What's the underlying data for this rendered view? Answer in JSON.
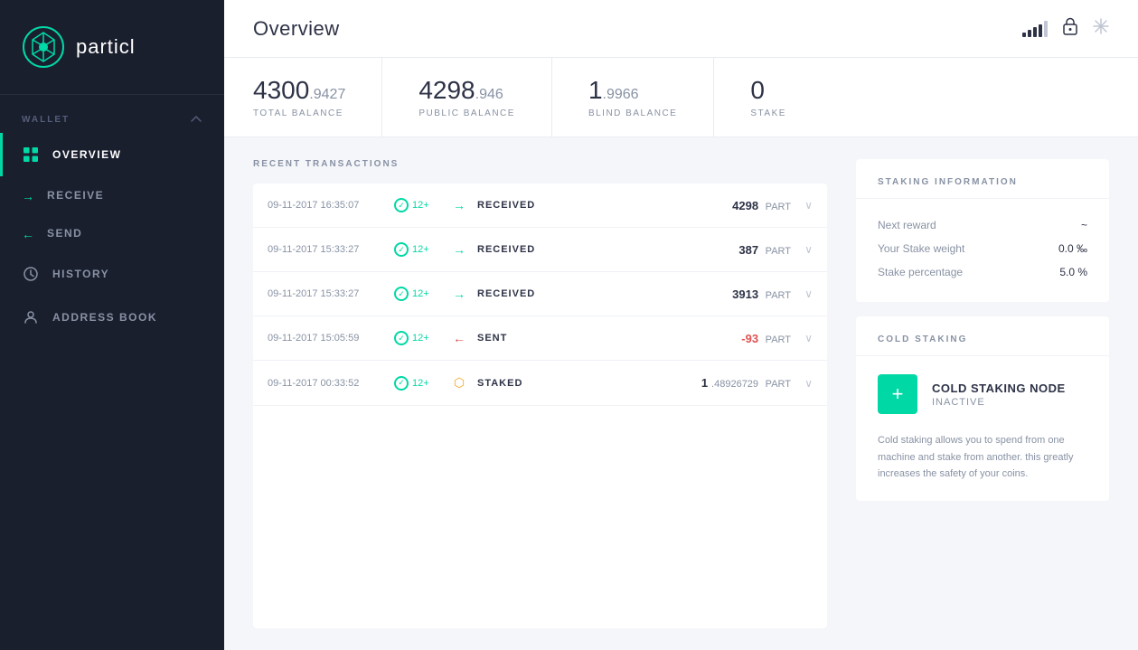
{
  "app": {
    "name": "particl",
    "logo_text": "particl"
  },
  "sidebar": {
    "wallet_label": "WALLET",
    "nav_items": [
      {
        "id": "overview",
        "label": "OVERVIEW",
        "icon": "grid-icon",
        "active": true
      },
      {
        "id": "receive",
        "label": "RECEIVE",
        "icon": "arrow-right-icon",
        "active": false
      },
      {
        "id": "send",
        "label": "SEND",
        "icon": "arrow-left-icon",
        "active": false
      },
      {
        "id": "history",
        "label": "HISTORY",
        "icon": "clock-icon",
        "active": false
      },
      {
        "id": "address-book",
        "label": "ADDRESS BOOK",
        "icon": "person-icon",
        "active": false
      }
    ]
  },
  "header": {
    "title": "Overview"
  },
  "balances": [
    {
      "id": "total",
      "whole": "4300",
      "decimal": ".9427",
      "label": "TOTAL BALANCE"
    },
    {
      "id": "public",
      "whole": "4298",
      "decimal": ".946",
      "label": "PUBLIC BALANCE"
    },
    {
      "id": "blind",
      "whole": "1",
      "decimal": ".9966",
      "label": "BLIND BALANCE"
    },
    {
      "id": "stake",
      "whole": "0",
      "decimal": "",
      "label": "STAKE"
    }
  ],
  "transactions": {
    "section_title": "RECENT TRANSACTIONS",
    "rows": [
      {
        "date": "09-11-2017 16:35:07",
        "confirmations": "12+",
        "type": "RECEIVED",
        "direction": "in",
        "amount": "4298",
        "amount_decimal": "",
        "currency": "PART",
        "negative": false
      },
      {
        "date": "09-11-2017 15:33:27",
        "confirmations": "12+",
        "type": "RECEIVED",
        "direction": "in",
        "amount": "387",
        "amount_decimal": "",
        "currency": "PART",
        "negative": false
      },
      {
        "date": "09-11-2017 15:33:27",
        "confirmations": "12+",
        "type": "RECEIVED",
        "direction": "in",
        "amount": "3913",
        "amount_decimal": "",
        "currency": "PART",
        "negative": false
      },
      {
        "date": "09-11-2017 15:05:59",
        "confirmations": "12+",
        "type": "SENT",
        "direction": "out",
        "amount": "-93",
        "amount_decimal": "",
        "currency": "PART",
        "negative": true
      },
      {
        "date": "09-11-2017 00:33:52",
        "confirmations": "12+",
        "type": "STAKED",
        "direction": "stake",
        "amount": "1",
        "amount_decimal": ".48926729",
        "currency": "PART",
        "negative": false
      }
    ]
  },
  "staking_info": {
    "section_title": "STAKING INFORMATION",
    "rows": [
      {
        "label": "Next reward",
        "value": "~"
      },
      {
        "label": "Your Stake weight",
        "value": "0.0 ‰"
      },
      {
        "label": "Stake percentage",
        "value": "5.0 %"
      }
    ]
  },
  "cold_staking": {
    "section_title": "COLD STAKING",
    "add_button_label": "+",
    "node_title": "COLD STAKING NODE",
    "node_status": "INACTIVE",
    "description": "Cold staking allows you to spend from one machine and stake from another. this greatly increases the safety of your coins."
  }
}
